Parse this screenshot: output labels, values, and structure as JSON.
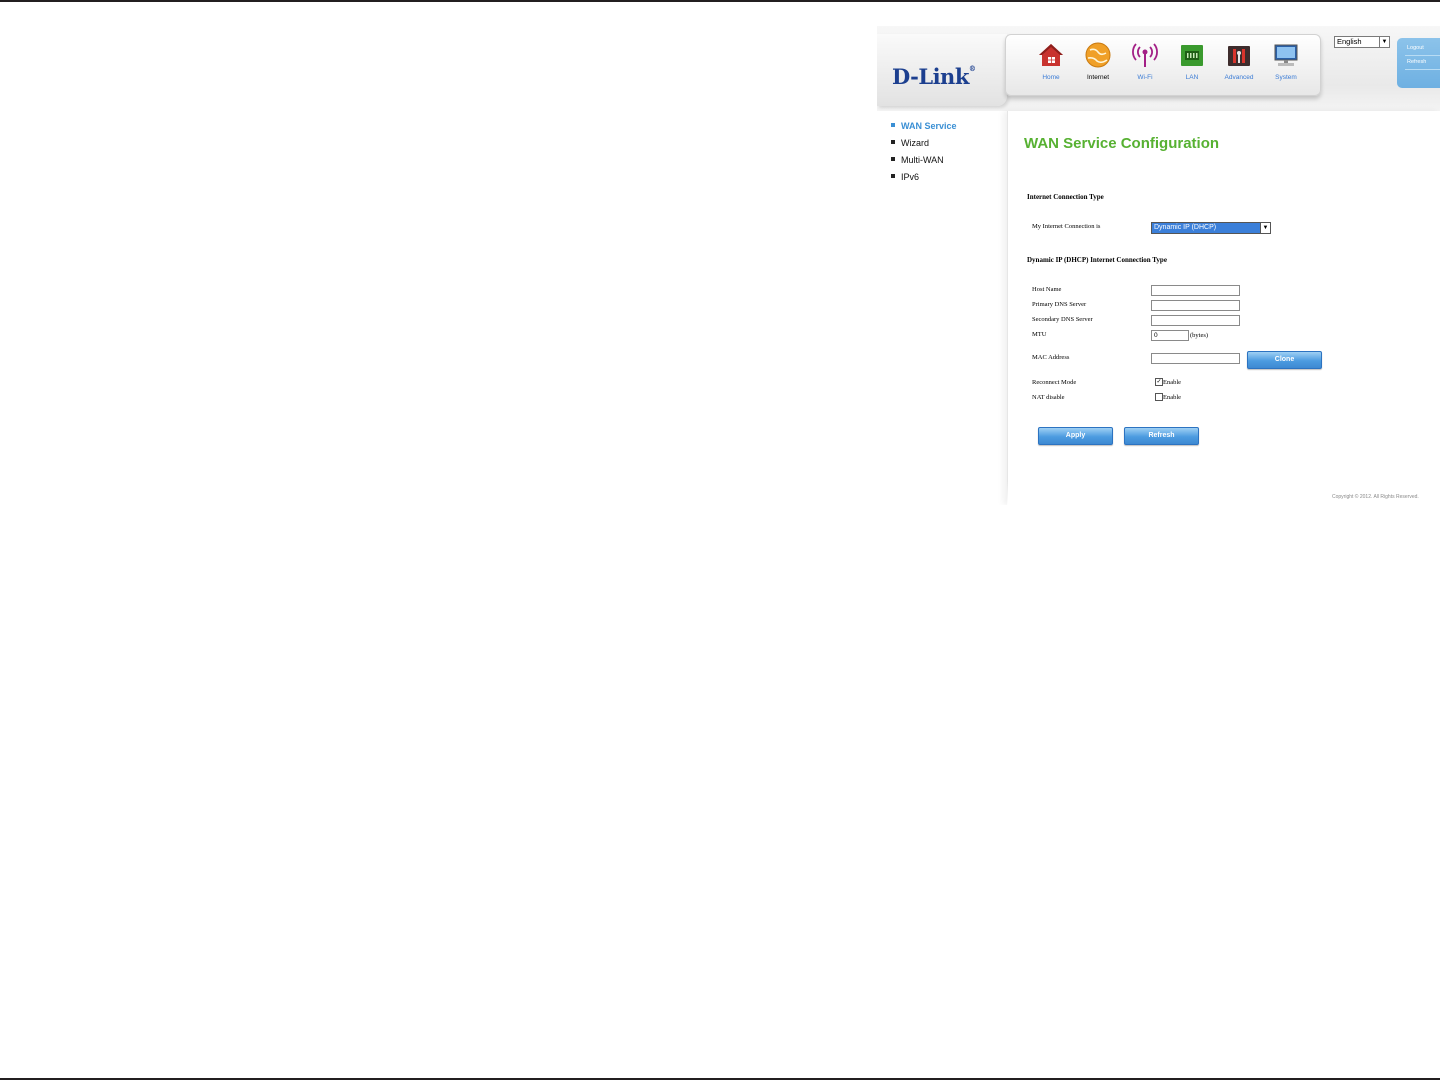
{
  "brand": {
    "logo": "D-Link",
    "reg_mark": "®"
  },
  "nav": [
    {
      "label": "Home",
      "icon": "home-icon",
      "active": false
    },
    {
      "label": "Internet",
      "icon": "globe-icon",
      "active": true
    },
    {
      "label": "Wi-Fi",
      "icon": "wifi-icon",
      "active": false
    },
    {
      "label": "LAN",
      "icon": "lan-icon",
      "active": false
    },
    {
      "label": "Advanced",
      "icon": "tools-icon",
      "active": false
    },
    {
      "label": "System",
      "icon": "monitor-icon",
      "active": false
    }
  ],
  "language": {
    "selected": "English"
  },
  "user_links": {
    "logout": "Logout",
    "refresh": "Refresh"
  },
  "sidebar": {
    "items": [
      {
        "label": "WAN Service",
        "active": true
      },
      {
        "label": "Wizard",
        "active": false
      },
      {
        "label": "Multi-WAN",
        "active": false
      },
      {
        "label": "IPv6",
        "active": false
      }
    ]
  },
  "main": {
    "title": "WAN Service Configuration",
    "section1": "Internet Connection Type",
    "connection_label": "My Internet Connection is",
    "connection_value": "Dynamic IP (DHCP)",
    "section2": "Dynamic IP (DHCP) Internet Connection Type",
    "host_name_label": "Host Name",
    "host_name_value": "",
    "primary_dns_label": "Primary DNS Server",
    "primary_dns_value": "",
    "secondary_dns_label": "Secondary DNS Server",
    "secondary_dns_value": "",
    "mtu_label": "MTU",
    "mtu_value": "0",
    "mtu_unit": "(bytes)",
    "mac_label": "MAC Address",
    "mac_value": "",
    "clone_label": "Clone",
    "reconnect_label": "Reconnect Mode",
    "reconnect_checked": true,
    "reconnect_option": "Enable",
    "nat_label": "NAT disable",
    "nat_checked": false,
    "nat_option": "Enable",
    "apply_label": "Apply",
    "refresh_label": "Refresh"
  },
  "footer": {
    "copyright": "Copyright © 2012. All Rights Reserved."
  },
  "colors": {
    "accent_blue": "#3a8fd4",
    "title_green": "#57b132",
    "logo_navy": "#1c3f8f",
    "button_blue": "#4c9be0"
  }
}
